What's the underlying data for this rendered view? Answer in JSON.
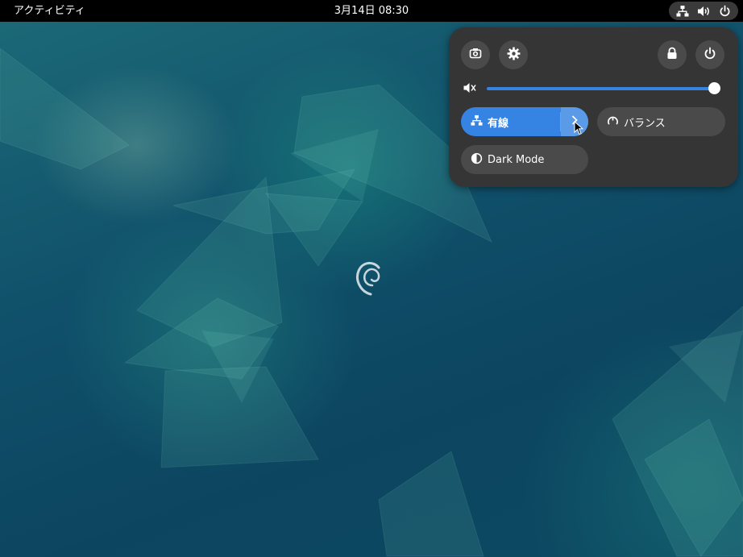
{
  "topbar": {
    "activities_label": "アクティビティ",
    "clock": "3月14日  08:30",
    "status_icons": [
      "network-wired-icon",
      "volume-icon",
      "power-icon"
    ]
  },
  "quick_settings": {
    "top_buttons": [
      "camera-icon",
      "gear-icon",
      "lock-icon",
      "power-icon"
    ],
    "volume": {
      "icon": "volume-muted-icon",
      "level": 1.0
    },
    "toggles": {
      "wired": {
        "label": "有線",
        "icon": "network-wired-icon",
        "active": true
      },
      "power_profile": {
        "label": "バランス",
        "icon": "power-profile-icon"
      },
      "dark_mode": {
        "label": "Dark Mode",
        "icon": "dark-mode-icon"
      }
    }
  },
  "colors": {
    "accent": "#3584e4",
    "panel_bg": "#353535",
    "button_bg": "#4a4a4a",
    "topbar_bg": "#000000"
  }
}
